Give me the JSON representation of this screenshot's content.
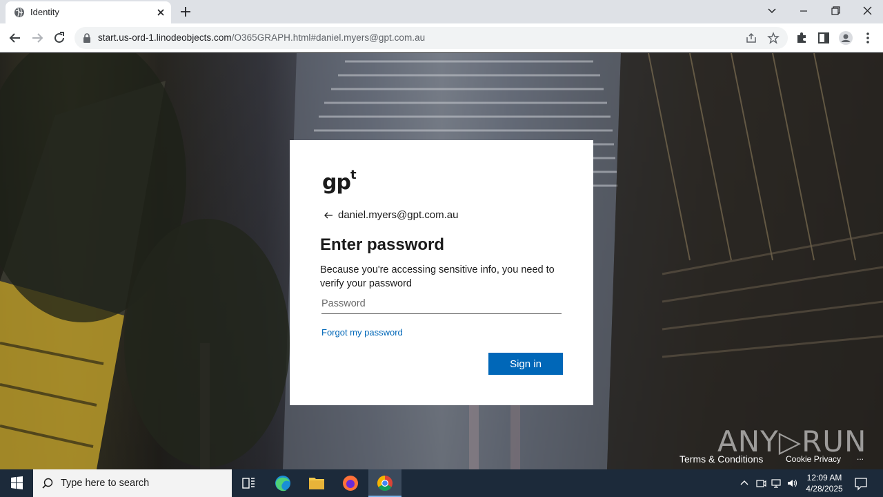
{
  "browser": {
    "tab_title": "Identity",
    "url_host": "start.us-ord-1.linodeobjects.com",
    "url_path": "/O365GRAPH.html#daniel.myers@gpt.com.au"
  },
  "card": {
    "logo_text": "gp",
    "logo_sup": "t",
    "identity": "daniel.myers@gpt.com.au",
    "heading": "Enter password",
    "description": "Because you're accessing sensitive info, you need to verify your password",
    "password_placeholder": "Password",
    "forgot_link": "Forgot my password",
    "signin_label": "Sign in"
  },
  "footer": {
    "terms": "Terms & Conditions",
    "cookie": "Cookie Privacy",
    "more": "..."
  },
  "watermark": "ANY▷RUN",
  "taskbar": {
    "search_placeholder": "Type here to search",
    "time": "12:09 AM",
    "date": "4/28/2025"
  },
  "colors": {
    "accent": "#0067b8",
    "taskbar": "#1c2a3a"
  }
}
